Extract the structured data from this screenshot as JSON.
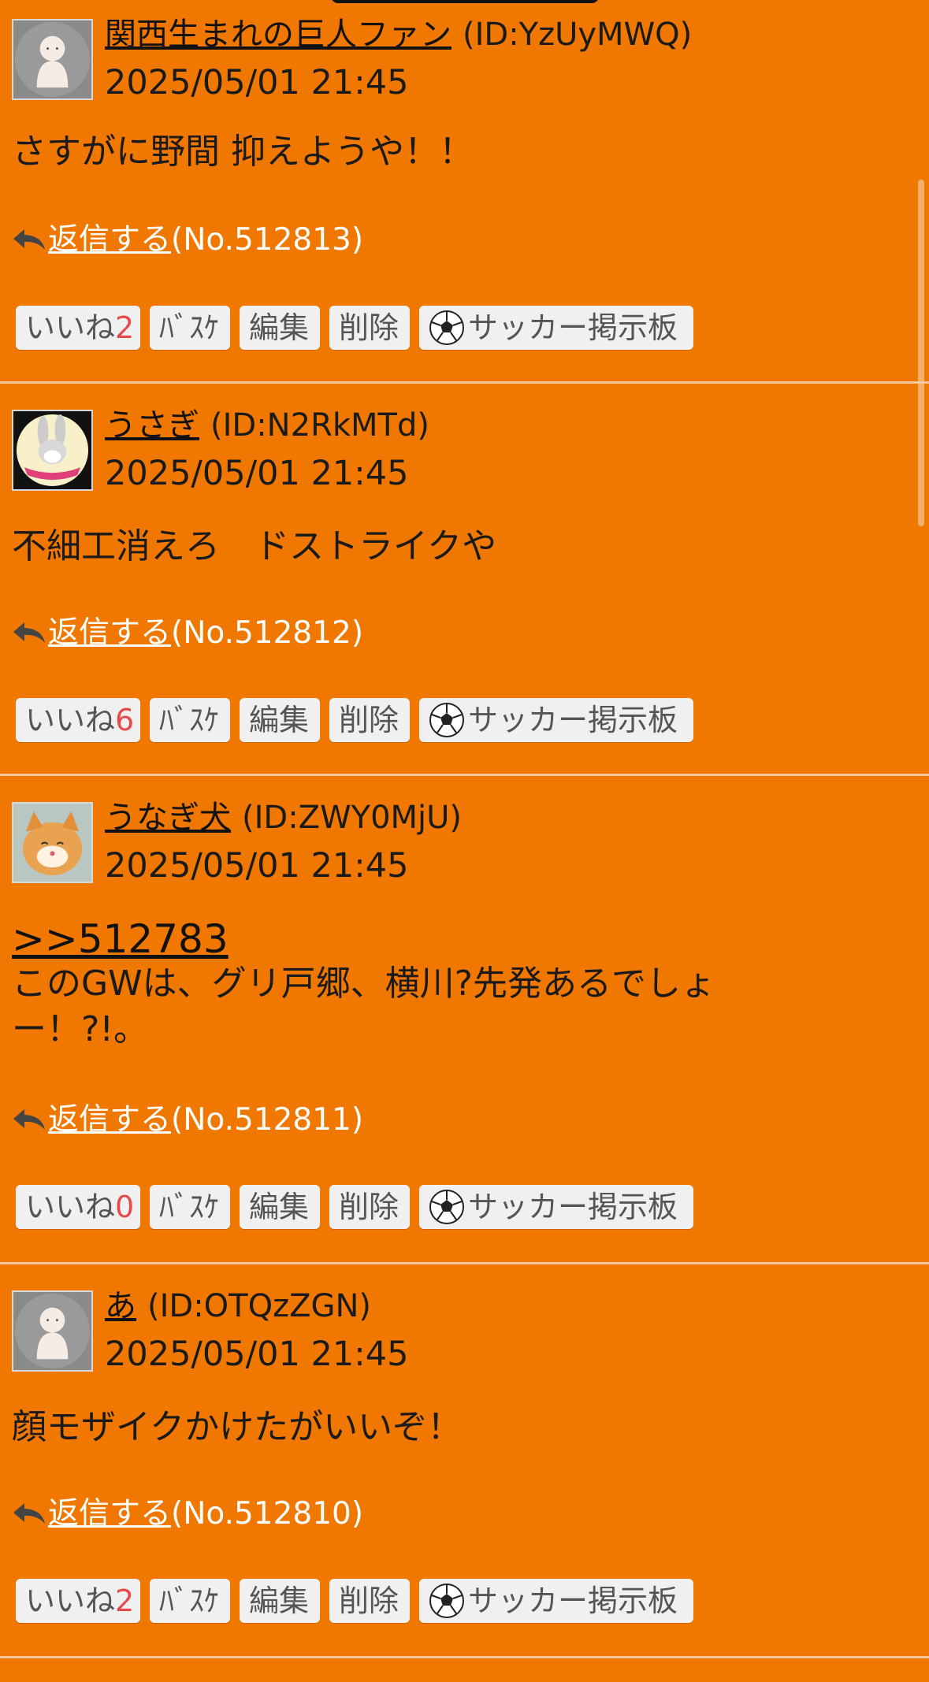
{
  "buttons": {
    "like_label": "いいね",
    "busuke_label": "ﾊﾞｽｹ",
    "edit_label": "編集",
    "delete_label": "削除",
    "soccer_label": "サッカー掲示板"
  },
  "reply_label": "返信する",
  "posts": [
    {
      "username": "関西生まれの巨人ファン",
      "user_id": "(ID:YzUyMWQ)",
      "date": "2025/05/01 21:45",
      "body_lines": [
        "さすがに野間 抑えようや！！"
      ],
      "post_no": "(No.512813)",
      "likes": "2",
      "avatar": "default-person"
    },
    {
      "username": "うさぎ",
      "user_id": "(ID:N2RkMTd)",
      "date": "2025/05/01 21:45",
      "body_lines": [
        "不細工消えろ　ドストライクや"
      ],
      "post_no": "(No.512812)",
      "likes": "6",
      "avatar": "rabbit"
    },
    {
      "username": "うなぎ犬",
      "user_id": "(ID:ZWY0MjU)",
      "date": "2025/05/01 21:45",
      "anchor": ">>512783",
      "body_lines": [
        "このGWは、グリ戸郷、横川?先発あるでしょ",
        "ー！?!。"
      ],
      "post_no": "(No.512811)",
      "likes": "0",
      "avatar": "cat"
    },
    {
      "username": "あ",
      "user_id": "(ID:OTQzZGN)",
      "date": "2025/05/01 21:45",
      "body_lines": [
        "顔モザイクかけたがいいぞ！"
      ],
      "post_no": "(No.512810)",
      "likes": "2",
      "avatar": "default-person"
    }
  ]
}
